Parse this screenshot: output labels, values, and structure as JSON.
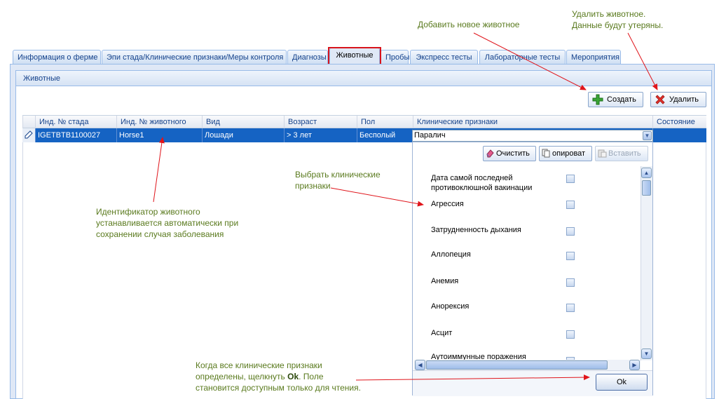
{
  "tabs": [
    {
      "label": "Информация о ферме"
    },
    {
      "label": "Эпи стада/Клинические признаки/Меры контроля"
    },
    {
      "label": "Диагнозы"
    },
    {
      "label": "Животные"
    },
    {
      "label": "Пробы"
    },
    {
      "label": "Экспресс тесты"
    },
    {
      "label": "Лабораторные тесты"
    },
    {
      "label": "Мероприятия"
    }
  ],
  "panel": {
    "title": "Животные"
  },
  "toolbar": {
    "create_label": "Создать",
    "delete_label": "Удалить"
  },
  "grid": {
    "columns": [
      "Инд. № стада",
      "Инд. № животного",
      "Вид",
      "Возраст",
      "Пол",
      "Клинические признаки",
      "Состояние"
    ],
    "rows": [
      {
        "herd_id": "IGETBTB1100027",
        "animal_id": "Horse1",
        "species": "Лошади",
        "age": "> 3 лет",
        "sex": "Бесполый",
        "clinical_signs": "Паралич",
        "state": ""
      }
    ]
  },
  "dropdown": {
    "clear_label": "Очистить",
    "copy_label": "опироват",
    "paste_label": "Вставить",
    "items": [
      {
        "label": "Дата самой последней противоклюшной вакинации"
      },
      {
        "label": "Агрессия"
      },
      {
        "label": "Затрудненность дыхания"
      },
      {
        "label": "Аллопеция"
      },
      {
        "label": "Анемия"
      },
      {
        "label": "Анорексия"
      },
      {
        "label": "Асцит"
      },
      {
        "label": "Аутоиммунные поражения межкопытной"
      }
    ],
    "ok_label": "Ok"
  },
  "annotations": {
    "add_animal": "Добавить новое животное",
    "delete_animal_1": "Удалить животное.",
    "delete_animal_2": "Данные будут утеряны.",
    "choose_signs_1": "Выбрать клинические",
    "choose_signs_2": "признаки",
    "animal_id_1": "Идентификатор животного",
    "animal_id_2": "устанавливается автоматически при",
    "animal_id_3": "сохранении случая заболевания",
    "ok_note_1": "Когда все клинические признаки",
    "ok_note_2a": "определены, щелкнуть ",
    "ok_note_2b": "Ok",
    "ok_note_2c": ". Поле",
    "ok_note_3": "становится доступным только для чтения."
  },
  "colors": {
    "selection": "#1563c3",
    "arrow": "#e0151b",
    "annotation": "#5a7a1e"
  }
}
